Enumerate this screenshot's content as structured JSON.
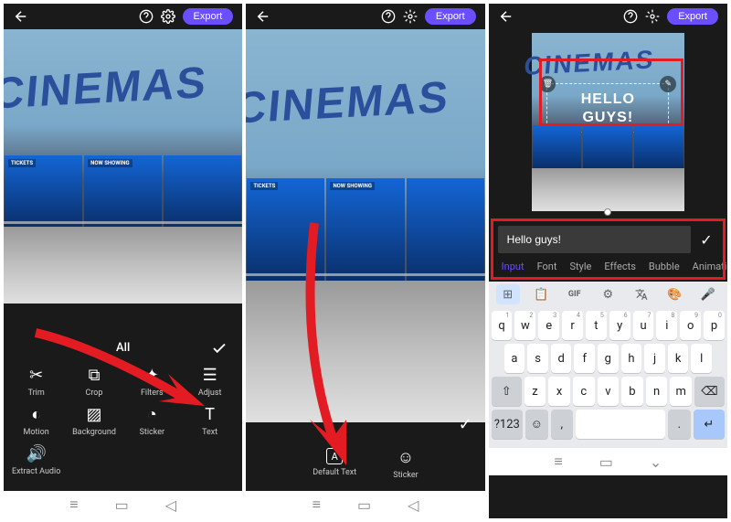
{
  "common": {
    "export_label": "Export",
    "sign_text": "CINEMAS",
    "store_labels": [
      "TICKETS",
      "NOW SHOWING"
    ]
  },
  "screen1": {
    "tool_header": "All",
    "tools": [
      {
        "label": "Trim"
      },
      {
        "label": "Crop"
      },
      {
        "label": "Filters"
      },
      {
        "label": "Adjust"
      },
      {
        "label": "Motion"
      },
      {
        "label": "Background"
      },
      {
        "label": "Sticker"
      },
      {
        "label": "Text"
      },
      {
        "label": "Extract Audio"
      }
    ]
  },
  "screen2": {
    "tools": [
      {
        "label": "Default Text"
      },
      {
        "label": "Sticker"
      }
    ]
  },
  "screen3": {
    "overlay_text": "HELLO GUYS!",
    "input_value": "Hello guys!",
    "tabs": [
      "Input",
      "Font",
      "Style",
      "Effects",
      "Bubble",
      "Animation"
    ],
    "kb_toolbar": [
      "stickers",
      "clipboard",
      "gif",
      "settings",
      "translate",
      "palette",
      "mic"
    ],
    "kb_rows": [
      [
        {
          "k": "q",
          "h": "1"
        },
        {
          "k": "w",
          "h": "2"
        },
        {
          "k": "e",
          "h": "3"
        },
        {
          "k": "r",
          "h": "4"
        },
        {
          "k": "t",
          "h": "5"
        },
        {
          "k": "y",
          "h": "6"
        },
        {
          "k": "u",
          "h": "7"
        },
        {
          "k": "i",
          "h": "8"
        },
        {
          "k": "o",
          "h": "9"
        },
        {
          "k": "p",
          "h": "0"
        }
      ],
      [
        {
          "k": "a"
        },
        {
          "k": "s"
        },
        {
          "k": "d"
        },
        {
          "k": "f"
        },
        {
          "k": "g"
        },
        {
          "k": "h"
        },
        {
          "k": "j"
        },
        {
          "k": "k"
        },
        {
          "k": "l"
        }
      ],
      [
        {
          "k": "⇧",
          "fn": true,
          "wide": true
        },
        {
          "k": "z"
        },
        {
          "k": "x"
        },
        {
          "k": "c"
        },
        {
          "k": "v"
        },
        {
          "k": "b"
        },
        {
          "k": "n"
        },
        {
          "k": "m"
        },
        {
          "k": "⌫",
          "fn": true,
          "wide": true
        }
      ]
    ],
    "kb_bottom": {
      "sym": "?123",
      "emoji": "☺",
      "comma": ",",
      "space": "",
      "period": ".",
      "enter": "↵"
    }
  }
}
